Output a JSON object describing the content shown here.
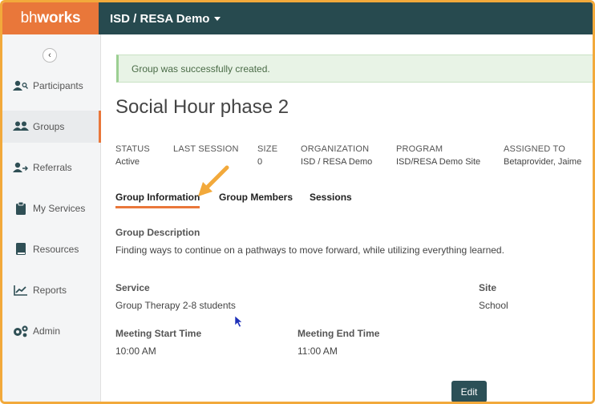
{
  "brand": {
    "logo_light": "bh",
    "logo_bold": "works",
    "color": "#e9773a"
  },
  "header": {
    "org": "ISD / RESA Demo"
  },
  "sidebar": {
    "items": [
      {
        "label": "Participants",
        "icon": "participants-icon"
      },
      {
        "label": "Groups",
        "icon": "groups-icon",
        "active": true
      },
      {
        "label": "Referrals",
        "icon": "referrals-icon"
      },
      {
        "label": "My Services",
        "icon": "clipboard-icon"
      },
      {
        "label": "Resources",
        "icon": "book-icon"
      },
      {
        "label": "Reports",
        "icon": "chart-icon"
      },
      {
        "label": "Admin",
        "icon": "gears-icon"
      }
    ]
  },
  "alert": {
    "message": "Group was successfully created."
  },
  "group": {
    "title": "Social Hour phase 2",
    "meta": [
      {
        "label": "STATUS",
        "value": "Active"
      },
      {
        "label": "LAST SESSION",
        "value": ""
      },
      {
        "label": "SIZE",
        "value": "0"
      },
      {
        "label": "ORGANIZATION",
        "value": "ISD / RESA Demo"
      },
      {
        "label": "PROGRAM",
        "value": "ISD/RESA Demo Site"
      },
      {
        "label": "ASSIGNED TO",
        "value": "Betaprovider, Jaime"
      }
    ]
  },
  "tabs": [
    {
      "label": "Group Information",
      "active": true
    },
    {
      "label": "Group Members"
    },
    {
      "label": "Sessions"
    }
  ],
  "info": {
    "description_label": "Group Description",
    "description": "Finding ways to continue on a pathways to move forward, while utilizing everything learned.",
    "service_label": "Service",
    "service": "Group Therapy 2-8 students",
    "site_label": "Site",
    "site": "School",
    "start_label": "Meeting Start Time",
    "start": "10:00 AM",
    "end_label": "Meeting End Time",
    "end": "11:00 AM"
  },
  "actions": {
    "edit": "Edit"
  },
  "colors": {
    "accent": "#e9773a",
    "topbar": "#274a4f",
    "annotation": "#f2a93b"
  }
}
